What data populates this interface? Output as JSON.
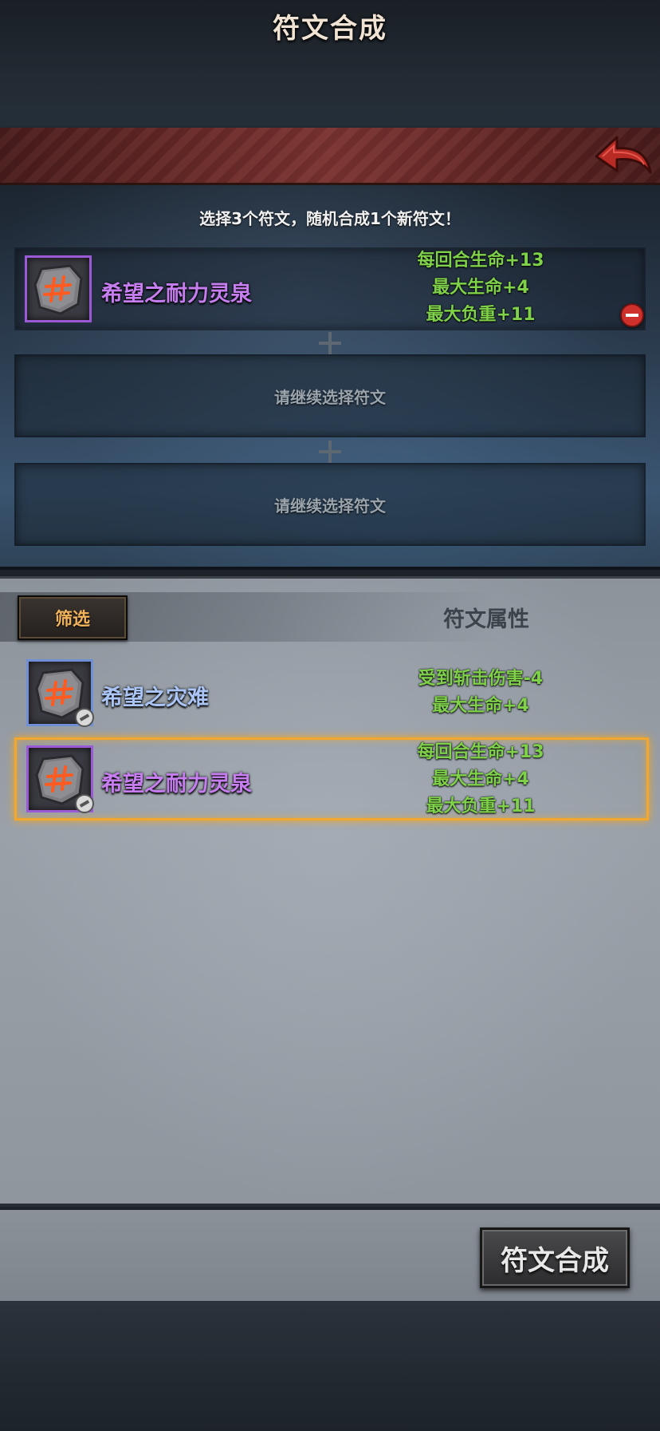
{
  "header": {
    "title": "符文合成",
    "back_icon": "back-arrow-icon"
  },
  "selection": {
    "instruction": "选择3个符文，随机合成1个新符文！",
    "selected_rune": {
      "name": "希望之耐力灵泉",
      "rarity_color": "#9b59d6",
      "stats": [
        "每回合生命+13",
        "最大生命+4",
        "最大负重+11"
      ]
    },
    "empty_slot_text_1": "请继续选择符文",
    "empty_slot_text_2": "请继续选择符文"
  },
  "inventory": {
    "filter_label": "筛选",
    "attr_header": "符文属性",
    "items": [
      {
        "name": "希望之灾难",
        "rarity_color": "#6f8fd6",
        "stats": [
          "受到斩击伤害-4",
          "最大生命+4"
        ]
      },
      {
        "name": "希望之耐力灵泉",
        "rarity_color": "#9b59d6",
        "stats": [
          "每回合生命+13",
          "最大生命+4",
          "最大负重+11"
        ],
        "selected": true
      }
    ]
  },
  "footer": {
    "synth_label": "符文合成"
  },
  "colors": {
    "stat_green": "#7fd14a",
    "selection_glow": "#f5a623",
    "title_bar": "#6e2c2a"
  }
}
